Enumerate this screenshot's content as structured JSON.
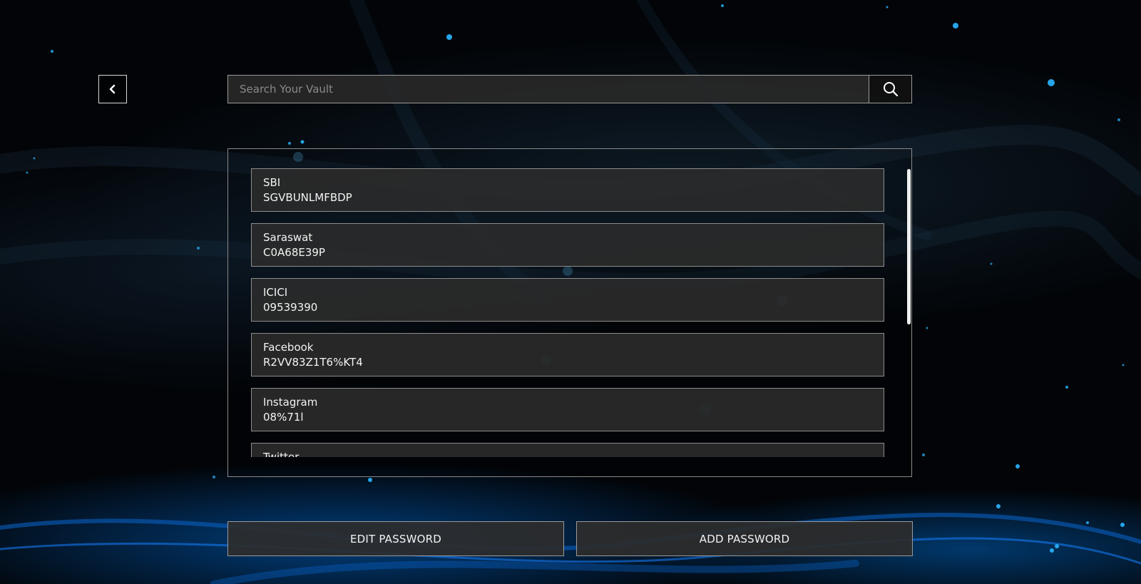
{
  "search": {
    "placeholder": "Search Your Vault",
    "value": ""
  },
  "nav": {
    "back_icon": "chevron-left-icon",
    "search_icon": "search-icon"
  },
  "vault": {
    "entries": [
      {
        "name": "SBI",
        "secret": "SGVBUNLMFBDP"
      },
      {
        "name": "Saraswat",
        "secret": "C0A68E39P"
      },
      {
        "name": "ICICI",
        "secret": "09539390"
      },
      {
        "name": "Facebook",
        "secret": "R2VV83Z1T6%KT4"
      },
      {
        "name": "Instagram",
        "secret": "08%71l"
      },
      {
        "name": "Twitter",
        "secret": ""
      }
    ]
  },
  "actions": {
    "edit_label": "EDIT PASSWORD",
    "add_label": "ADD PASSWORD"
  },
  "colors": {
    "background": "#020407",
    "accent": "#1e90ff",
    "panel": "#2a2a2a",
    "border": "#9a9a9a"
  }
}
